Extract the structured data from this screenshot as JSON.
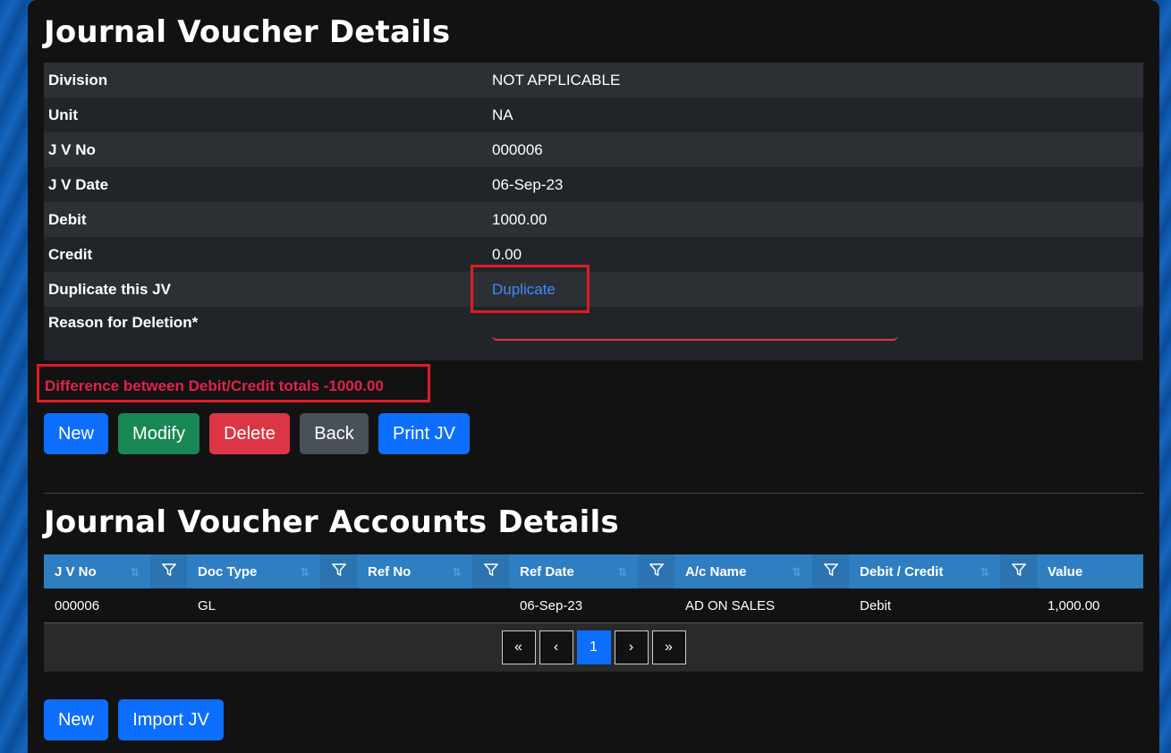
{
  "details": {
    "title": "Journal Voucher Details",
    "rows": [
      {
        "label": "Division",
        "value": "NOT APPLICABLE"
      },
      {
        "label": "Unit",
        "value": "NA"
      },
      {
        "label": "J V No",
        "value": "000006"
      },
      {
        "label": "J V Date",
        "value": "06-Sep-23"
      },
      {
        "label": "Debit",
        "value": "1000.00"
      },
      {
        "label": "Credit",
        "value": "0.00"
      },
      {
        "label": "Duplicate this JV",
        "link": "Duplicate"
      },
      {
        "label": "Reason for Deletion*",
        "value": ""
      }
    ]
  },
  "warning": "Difference between Debit/Credit totals -1000.00",
  "actions": {
    "new": "New",
    "modify": "Modify",
    "delete": "Delete",
    "back": "Back",
    "print": "Print JV"
  },
  "accounts": {
    "title": "Journal Voucher Accounts Details",
    "columns": [
      "J V No",
      "Doc Type",
      "Ref No",
      "Ref Date",
      "A/c Name",
      "Debit / Credit",
      "Value"
    ],
    "rows": [
      [
        "000006",
        "GL",
        "",
        "06-Sep-23",
        "AD ON SALES",
        "Debit",
        "1,000.00"
      ]
    ],
    "pager": {
      "first": "«",
      "prev": "‹",
      "page": "1",
      "next": "›",
      "last": "»"
    }
  },
  "bottom_actions": {
    "new": "New",
    "import": "Import JV"
  },
  "icons": {
    "filter": "filter-icon",
    "sort": "sort-icon"
  },
  "colors": {
    "primary": "#0d6efd",
    "success": "#198754",
    "danger": "#dc3545",
    "secondary": "#495057",
    "header": "#2f7ec1"
  }
}
